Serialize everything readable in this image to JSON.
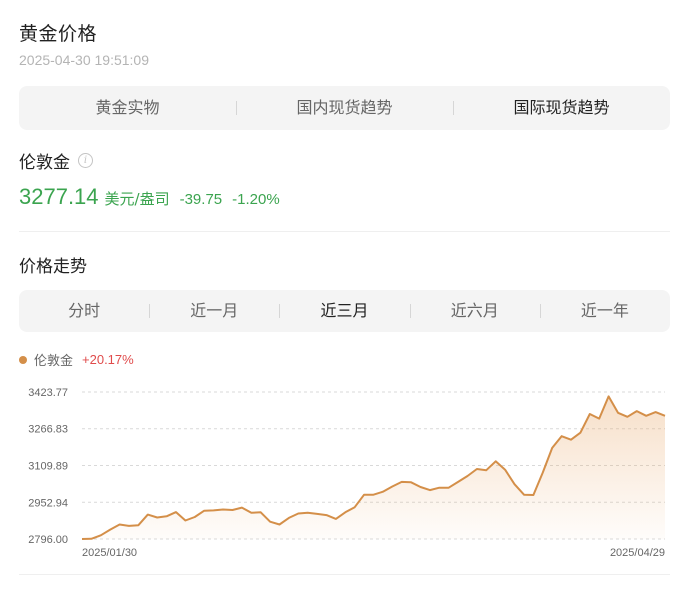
{
  "header": {
    "title": "黄金价格",
    "timestamp": "2025-04-30 19:51:09"
  },
  "tabs": [
    {
      "label": "黄金实物",
      "active": false
    },
    {
      "label": "国内现货趋势",
      "active": false
    },
    {
      "label": "国际现货趋势",
      "active": true
    }
  ],
  "quote": {
    "name": "伦敦金",
    "info_icon": "info-icon",
    "price": "3277.14",
    "unit": "美元/盎司",
    "change": "-39.75",
    "change_pct": "-1.20%",
    "color": "#3ba44f"
  },
  "trend": {
    "title": "价格走势",
    "ranges": [
      {
        "label": "分时",
        "active": false
      },
      {
        "label": "近一月",
        "active": false
      },
      {
        "label": "近三月",
        "active": true
      },
      {
        "label": "近六月",
        "active": false
      },
      {
        "label": "近一年",
        "active": false
      }
    ],
    "legend": {
      "name": "伦敦金",
      "change": "+20.17%",
      "dot_color": "#d48f49",
      "change_color": "#e04b4b"
    }
  },
  "chart_data": {
    "type": "area",
    "series": [
      {
        "name": "伦敦金",
        "color": "#d48f49",
        "values": [
          2796,
          2797,
          2812,
          2836,
          2858,
          2852,
          2855,
          2900,
          2888,
          2893,
          2911,
          2875,
          2890,
          2917,
          2918,
          2922,
          2920,
          2930,
          2908,
          2910,
          2870,
          2858,
          2886,
          2905,
          2908,
          2903,
          2898,
          2882,
          2910,
          2932,
          2985,
          2985,
          2998,
          3020,
          3040,
          3038,
          3018,
          3005,
          3015,
          3015,
          3040,
          3065,
          3095,
          3090,
          3128,
          3092,
          3030,
          2985,
          2984,
          3080,
          3185,
          3235,
          3220,
          3250,
          3330,
          3310,
          3405,
          3335,
          3318,
          3342,
          3322,
          3338,
          3322
        ]
      }
    ],
    "x_start": "2025/01/30",
    "x_end": "2025/04/29",
    "yticks": [
      "3423.77",
      "3266.83",
      "3109.89",
      "2952.94",
      "2796.00"
    ],
    "ylim": [
      2796.0,
      3423.77
    ],
    "grid": true
  }
}
